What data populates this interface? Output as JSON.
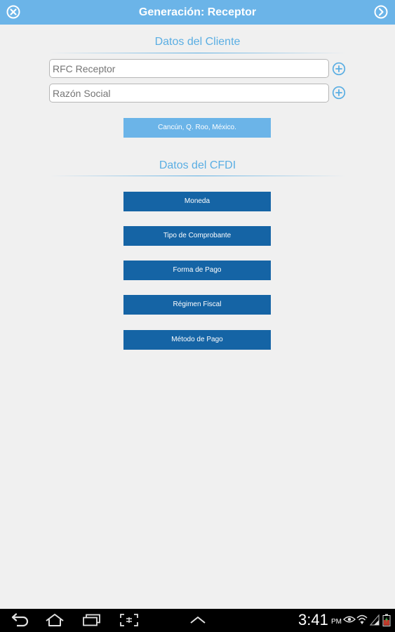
{
  "header": {
    "title": "Generación: Receptor",
    "close_icon": "close-circle-icon",
    "next_icon": "chevron-right-circle-icon"
  },
  "cliente": {
    "section_title": "Datos del Cliente",
    "rfc_placeholder": "RFC Receptor",
    "rfc_value": "",
    "razon_placeholder": "Razón Social",
    "razon_value": "",
    "add_icon": "plus-circle-icon",
    "location_button": "Cancún, Q. Roo, México."
  },
  "cfdi": {
    "section_title": "Datos del CFDI",
    "buttons": [
      "Moneda",
      "Tipo de Comprobante",
      "Forma de Pago",
      "Régimen Fiscal",
      "Método de Pago"
    ]
  },
  "statusbar": {
    "time": "3:41",
    "ampm": "PM",
    "icons": [
      "back-icon",
      "home-icon",
      "recent-apps-icon",
      "screenshot-icon",
      "up-arrow-icon",
      "eye-icon",
      "wifi-icon",
      "signal-icon",
      "battery-icon"
    ]
  },
  "colors": {
    "header": "#6bb4e8",
    "accent": "#5aaee3",
    "button_dark": "#1564a5",
    "button_light": "#6bb4e8",
    "background": "#f0f0f0"
  }
}
